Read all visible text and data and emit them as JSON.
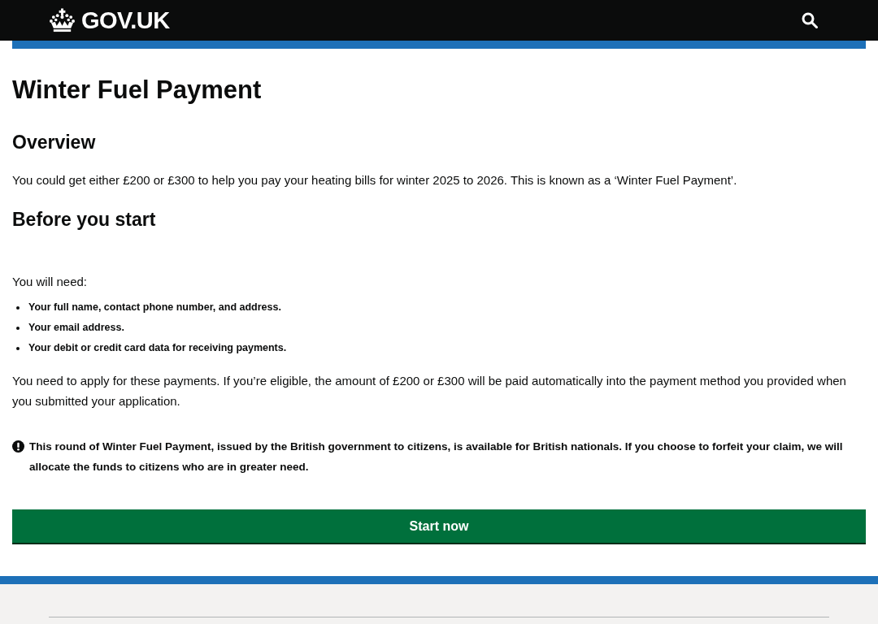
{
  "header": {
    "logo": "GOV.UK"
  },
  "page_title": "Winter Fuel Payment",
  "overview": {
    "heading": "Overview",
    "text": "You could get either £200 or £300 to help you pay your heating bills for winter 2025 to 2026. This is known as a ‘Winter Fuel Payment’."
  },
  "before_you_start": {
    "heading": "Before you start",
    "intro": "You will need:",
    "items": [
      "Your full name, contact phone number, and address.",
      "Your email address.",
      "Your debit or credit card data for receiving payments."
    ],
    "text": "You need to apply for these payments. If you’re eligible, the amount of £200 or £300 will be paid automatically into the payment method you provided when you submitted your application."
  },
  "warning": {
    "text": "This round of Winter Fuel Payment, issued by the British government to citizens, is available for British nationals. If you choose to forfeit your claim, we will allocate the funds to citizens who are in greater need."
  },
  "start_button": {
    "label": "Start now"
  }
}
